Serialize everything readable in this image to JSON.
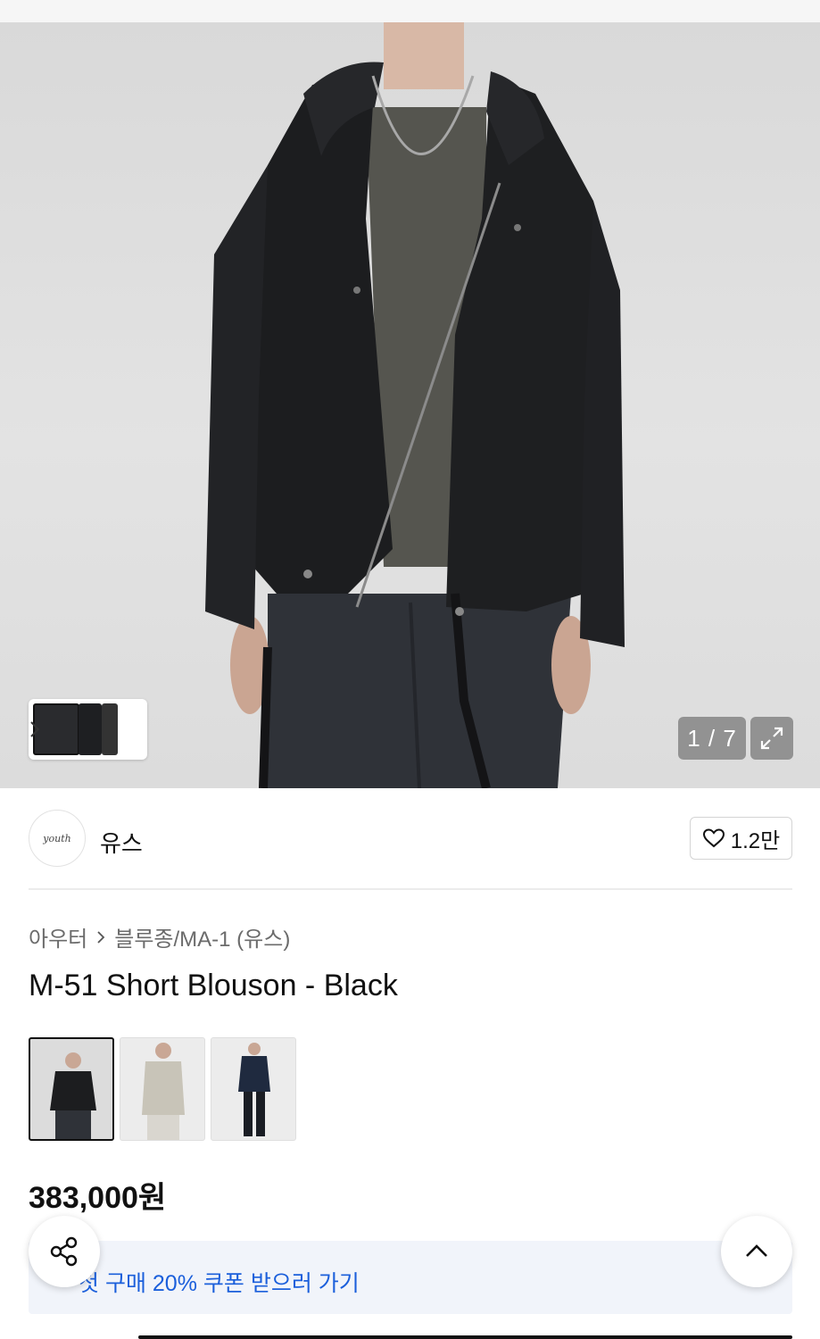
{
  "gallery": {
    "counter": "1 / 7",
    "current_index": 1,
    "total": 7
  },
  "brand": {
    "logo_text": "youth",
    "name": "유스"
  },
  "like": {
    "count": "1.2만"
  },
  "breadcrumb": {
    "level1": "아우터",
    "level2": "블루종/MA-1 (유스)"
  },
  "product": {
    "title": "M-51 Short Blouson - Black",
    "price": "383,000원",
    "color_options": [
      "black",
      "beige",
      "navy"
    ],
    "selected_color": "black"
  },
  "coupon": {
    "text": "첫 구매 20% 쿠폰 받으러 가기"
  },
  "colors": {
    "coupon_bg": "#f1f4fa",
    "coupon_text": "#1b5fdb",
    "jacket": "#1c1d1f"
  },
  "icons": {
    "share": "share-icon",
    "scroll_top": "chevron-up-icon",
    "like": "heart-icon",
    "expand": "expand-icon"
  }
}
